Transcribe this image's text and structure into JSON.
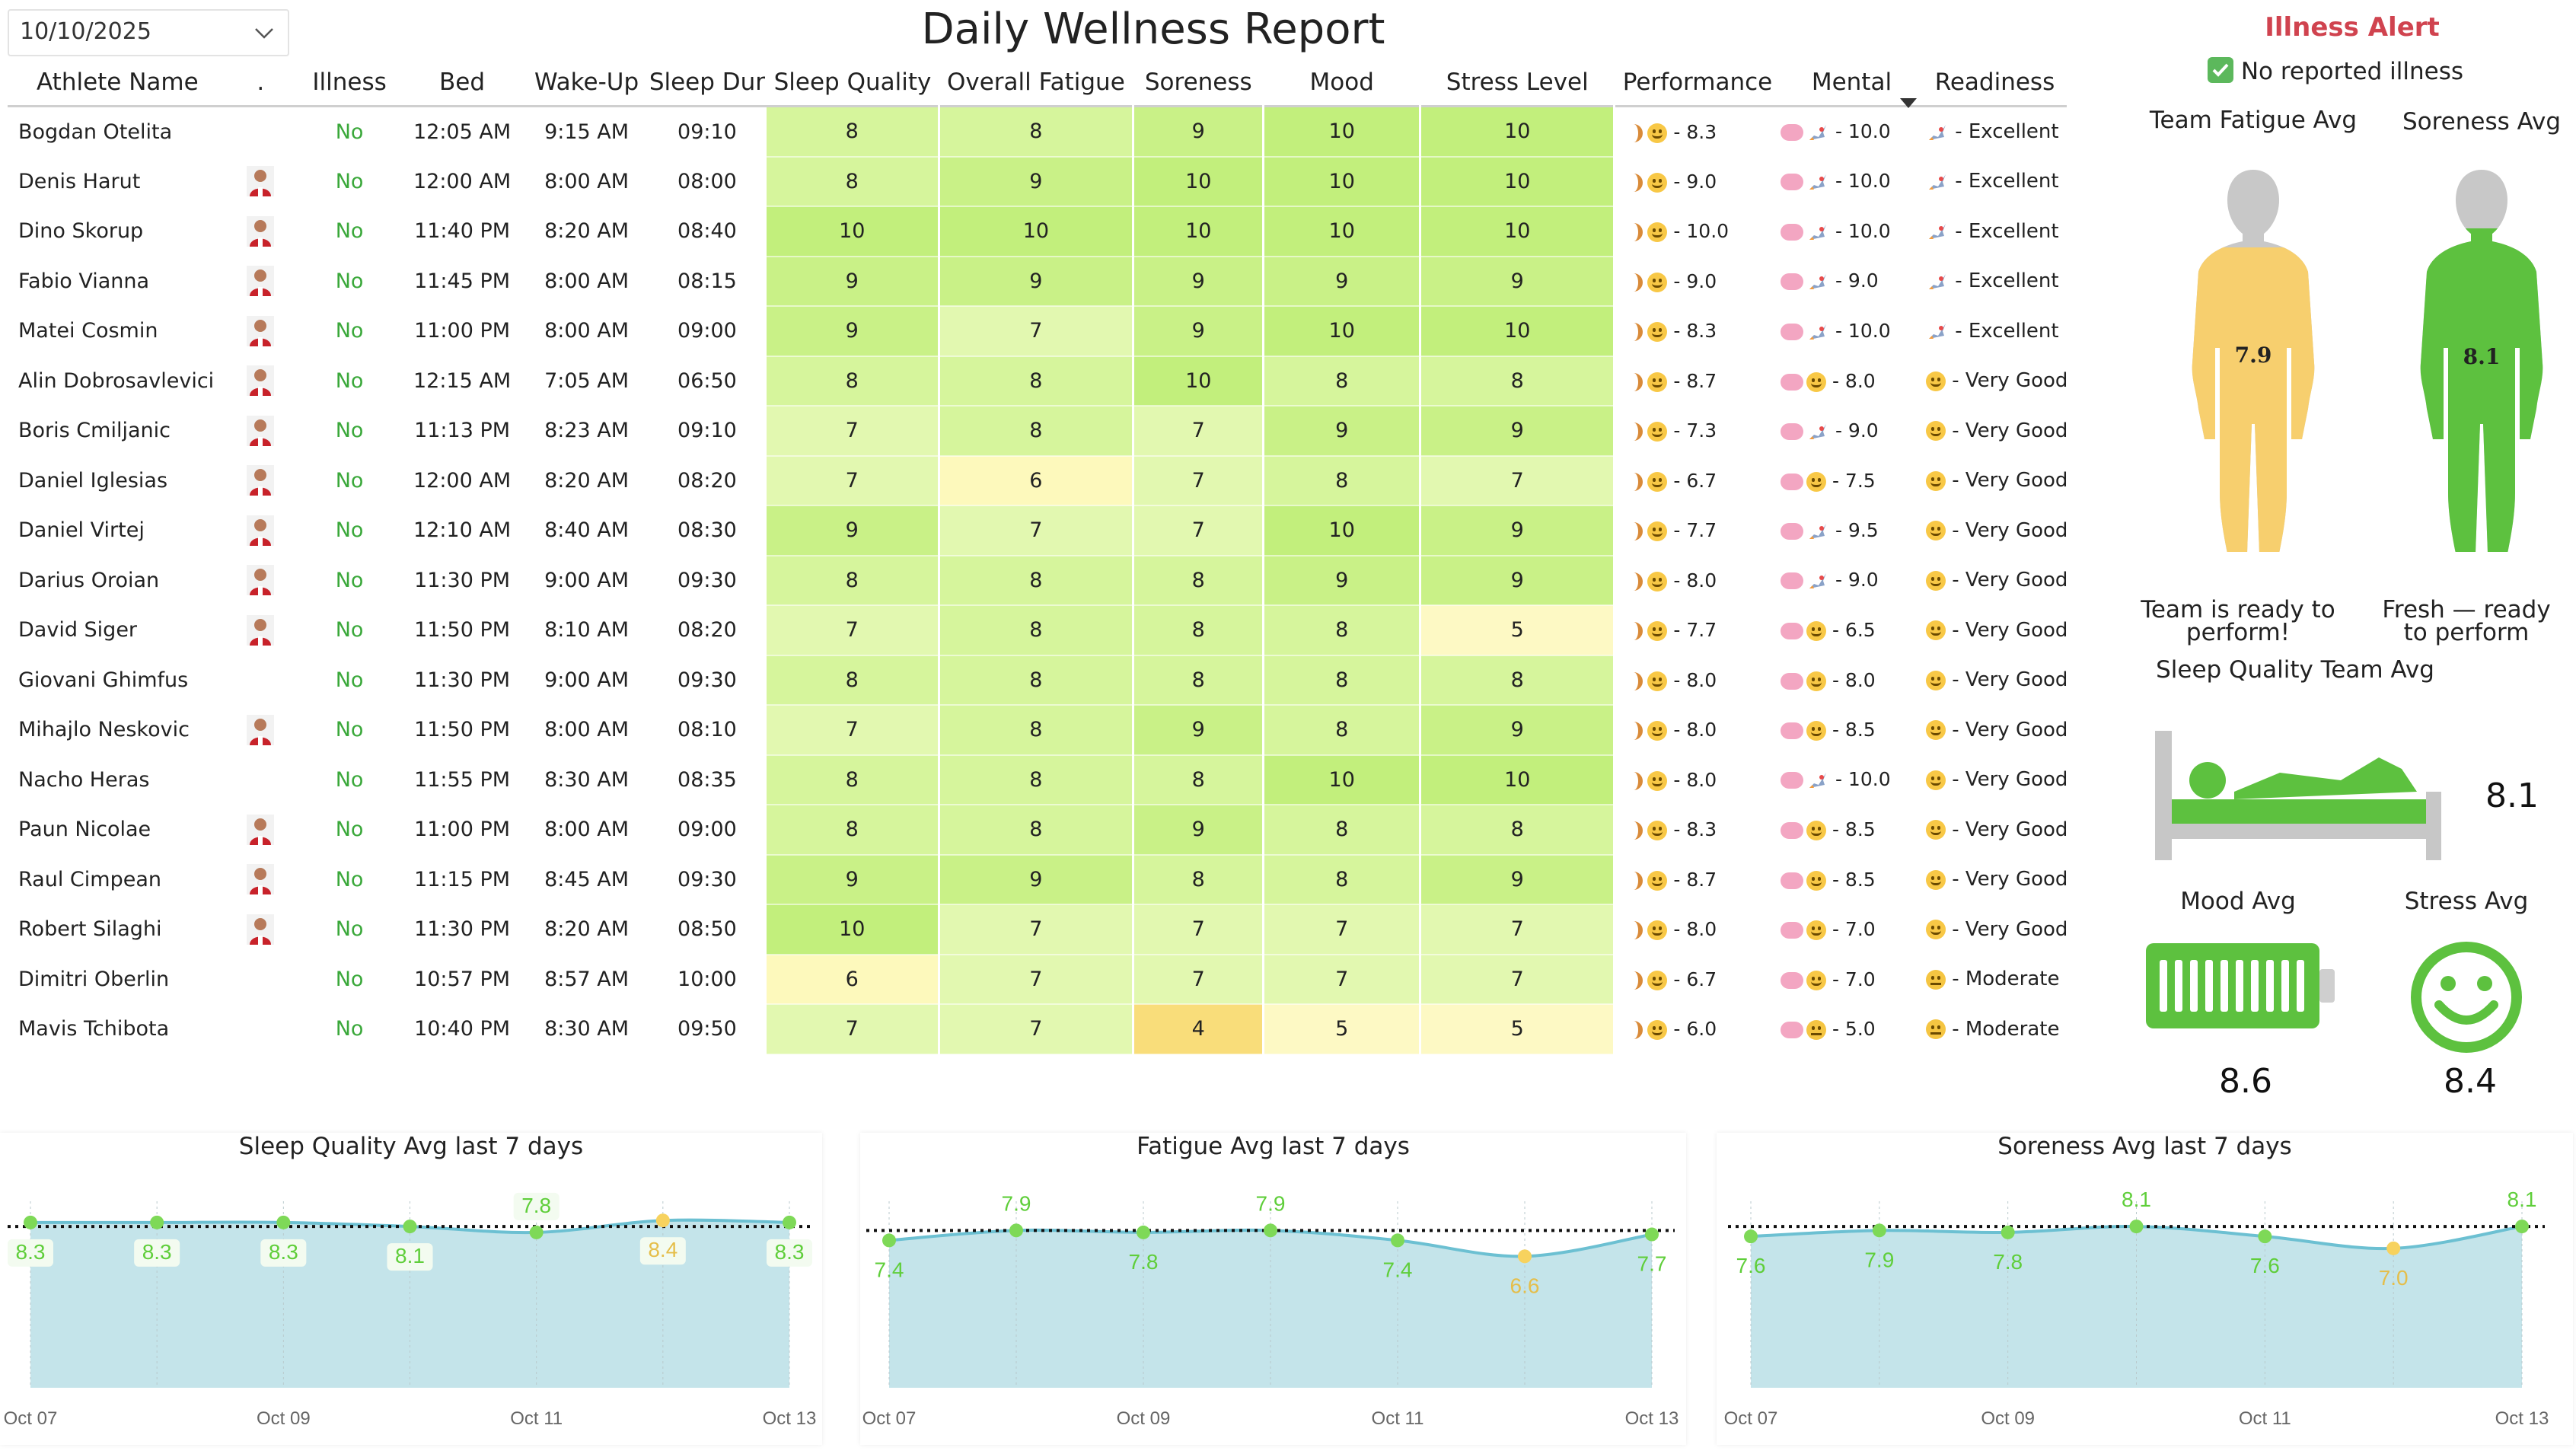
{
  "date_filter": "10/10/2025",
  "title": "Daily Wellness Report",
  "table": {
    "headers": [
      "Athlete Name",
      ".",
      "Illness",
      "Bed",
      "Wake-Up",
      "Sleep Dur",
      "Sleep Quality",
      "Overall Fatigue",
      "Soreness",
      "Mood",
      "Stress Level",
      "Performance",
      "Mental",
      "Readiness"
    ],
    "rows": [
      {
        "name": "Bogdan Otelita",
        "photo": false,
        "illness": "No",
        "bed": "12:05 AM",
        "wake": "9:15 AM",
        "dur": "09:10",
        "sq": "8",
        "fat": "8",
        "sor": "9",
        "mood": "10",
        "stress": "10",
        "perf": "- 8.3",
        "mental": "- 10.0",
        "mental_icon": "rocket",
        "ready": "- Excellent",
        "ready_icon": "rocket"
      },
      {
        "name": "Denis Harut",
        "photo": true,
        "illness": "No",
        "bed": "12:00 AM",
        "wake": "8:00 AM",
        "dur": "08:00",
        "sq": "8",
        "fat": "9",
        "sor": "10",
        "mood": "10",
        "stress": "10",
        "perf": "- 9.0",
        "mental": "- 10.0",
        "mental_icon": "rocket",
        "ready": "- Excellent",
        "ready_icon": "rocket"
      },
      {
        "name": "Dino Skorup",
        "photo": true,
        "illness": "No",
        "bed": "11:40 PM",
        "wake": "8:20 AM",
        "dur": "08:40",
        "sq": "10",
        "fat": "10",
        "sor": "10",
        "mood": "10",
        "stress": "10",
        "perf": "- 10.0",
        "mental": "- 10.0",
        "mental_icon": "rocket",
        "ready": "- Excellent",
        "ready_icon": "rocket"
      },
      {
        "name": "Fabio Vianna",
        "photo": true,
        "illness": "No",
        "bed": "11:45 PM",
        "wake": "8:00 AM",
        "dur": "08:15",
        "sq": "9",
        "fat": "9",
        "sor": "9",
        "mood": "9",
        "stress": "9",
        "perf": "- 9.0",
        "mental": "- 9.0",
        "mental_icon": "rocket",
        "ready": "- Excellent",
        "ready_icon": "rocket"
      },
      {
        "name": "Matei Cosmin",
        "photo": true,
        "illness": "No",
        "bed": "11:00 PM",
        "wake": "8:00 AM",
        "dur": "09:00",
        "sq": "9",
        "fat": "7",
        "sor": "9",
        "mood": "10",
        "stress": "10",
        "perf": "- 8.3",
        "mental": "- 10.0",
        "mental_icon": "rocket",
        "ready": "- Excellent",
        "ready_icon": "rocket"
      },
      {
        "name": "Alin Dobrosavlevici",
        "photo": true,
        "illness": "No",
        "bed": "12:15 AM",
        "wake": "7:05 AM",
        "dur": "06:50",
        "sq": "8",
        "fat": "8",
        "sor": "10",
        "mood": "8",
        "stress": "8",
        "perf": "- 8.7",
        "mental": "- 8.0",
        "mental_icon": "smile",
        "ready": "- Very Good",
        "ready_icon": "smile"
      },
      {
        "name": "Boris Cmiljanic",
        "photo": true,
        "illness": "No",
        "bed": "11:13 PM",
        "wake": "8:23 AM",
        "dur": "09:10",
        "sq": "7",
        "fat": "8",
        "sor": "7",
        "mood": "9",
        "stress": "9",
        "perf": "- 7.3",
        "mental": "- 9.0",
        "mental_icon": "rocket",
        "ready": "- Very Good",
        "ready_icon": "smile"
      },
      {
        "name": "Daniel Iglesias",
        "photo": true,
        "illness": "No",
        "bed": "12:00 AM",
        "wake": "8:20 AM",
        "dur": "08:20",
        "sq": "7",
        "fat": "6",
        "sor": "7",
        "mood": "8",
        "stress": "7",
        "perf": "- 6.7",
        "mental": "- 7.5",
        "mental_icon": "smile",
        "ready": "- Very Good",
        "ready_icon": "smile"
      },
      {
        "name": "Daniel Virtej",
        "photo": true,
        "illness": "No",
        "bed": "12:10 AM",
        "wake": "8:40 AM",
        "dur": "08:30",
        "sq": "9",
        "fat": "7",
        "sor": "7",
        "mood": "10",
        "stress": "9",
        "perf": "- 7.7",
        "mental": "- 9.5",
        "mental_icon": "rocket",
        "ready": "- Very Good",
        "ready_icon": "smile"
      },
      {
        "name": "Darius Oroian",
        "photo": true,
        "illness": "No",
        "bed": "11:30 PM",
        "wake": "9:00 AM",
        "dur": "09:30",
        "sq": "8",
        "fat": "8",
        "sor": "8",
        "mood": "9",
        "stress": "9",
        "perf": "- 8.0",
        "mental": "- 9.0",
        "mental_icon": "rocket",
        "ready": "- Very Good",
        "ready_icon": "smile"
      },
      {
        "name": "David Siger",
        "photo": true,
        "illness": "No",
        "bed": "11:50 PM",
        "wake": "8:10 AM",
        "dur": "08:20",
        "sq": "7",
        "fat": "8",
        "sor": "8",
        "mood": "8",
        "stress": "5",
        "perf": "- 7.7",
        "mental": "- 6.5",
        "mental_icon": "smile",
        "ready": "- Very Good",
        "ready_icon": "smile"
      },
      {
        "name": "Giovani Ghimfus",
        "photo": false,
        "illness": "No",
        "bed": "11:30 PM",
        "wake": "9:00 AM",
        "dur": "09:30",
        "sq": "8",
        "fat": "8",
        "sor": "8",
        "mood": "8",
        "stress": "8",
        "perf": "- 8.0",
        "mental": "- 8.0",
        "mental_icon": "smile",
        "ready": "- Very Good",
        "ready_icon": "smile"
      },
      {
        "name": "Mihajlo Neskovic",
        "photo": true,
        "illness": "No",
        "bed": "11:50 PM",
        "wake": "8:00 AM",
        "dur": "08:10",
        "sq": "7",
        "fat": "8",
        "sor": "9",
        "mood": "8",
        "stress": "9",
        "perf": "- 8.0",
        "mental": "- 8.5",
        "mental_icon": "smile",
        "ready": "- Very Good",
        "ready_icon": "smile"
      },
      {
        "name": "Nacho Heras",
        "photo": false,
        "illness": "No",
        "bed": "11:55 PM",
        "wake": "8:30 AM",
        "dur": "08:35",
        "sq": "8",
        "fat": "8",
        "sor": "8",
        "mood": "10",
        "stress": "10",
        "perf": "- 8.0",
        "mental": "- 10.0",
        "mental_icon": "rocket",
        "ready": "- Very Good",
        "ready_icon": "smile"
      },
      {
        "name": "Paun Nicolae",
        "photo": true,
        "illness": "No",
        "bed": "11:00 PM",
        "wake": "8:00 AM",
        "dur": "09:00",
        "sq": "8",
        "fat": "8",
        "sor": "9",
        "mood": "8",
        "stress": "8",
        "perf": "- 8.3",
        "mental": "- 8.5",
        "mental_icon": "smile",
        "ready": "- Very Good",
        "ready_icon": "smile"
      },
      {
        "name": "Raul Cimpean",
        "photo": true,
        "illness": "No",
        "bed": "11:15 PM",
        "wake": "8:45 AM",
        "dur": "09:30",
        "sq": "9",
        "fat": "9",
        "sor": "8",
        "mood": "8",
        "stress": "9",
        "perf": "- 8.7",
        "mental": "- 8.5",
        "mental_icon": "smile",
        "ready": "- Very Good",
        "ready_icon": "smile"
      },
      {
        "name": "Robert Silaghi",
        "photo": true,
        "illness": "No",
        "bed": "11:30 PM",
        "wake": "8:20 AM",
        "dur": "08:50",
        "sq": "10",
        "fat": "7",
        "sor": "7",
        "mood": "7",
        "stress": "7",
        "perf": "- 8.0",
        "mental": "- 7.0",
        "mental_icon": "smile",
        "ready": "- Very Good",
        "ready_icon": "smile"
      },
      {
        "name": "Dimitri Oberlin",
        "photo": false,
        "illness": "No",
        "bed": "10:57 PM",
        "wake": "8:57 AM",
        "dur": "10:00",
        "sq": "6",
        "fat": "7",
        "sor": "7",
        "mood": "7",
        "stress": "7",
        "perf": "- 6.7",
        "mental": "- 7.0",
        "mental_icon": "smile",
        "ready": "- Moderate",
        "ready_icon": "neutral"
      },
      {
        "name": "Mavis Tchibota",
        "photo": false,
        "illness": "No",
        "bed": "10:40 PM",
        "wake": "8:30 AM",
        "dur": "09:50",
        "sq": "7",
        "fat": "7",
        "sor": "4",
        "mood": "5",
        "stress": "5",
        "perf": "- 6.0",
        "mental": "- 5.0",
        "mental_icon": "neutral",
        "ready": "- Moderate",
        "ready_icon": "neutral"
      }
    ]
  },
  "side": {
    "alert_title": "Illness Alert",
    "alert_msg": "No reported illness",
    "fatigue_label": "Team Fatigue Avg",
    "fatigue_value": "7.9",
    "fatigue_note": "Team is ready to perform!",
    "soreness_label": "Soreness Avg",
    "soreness_value": "8.1",
    "soreness_note": "Fresh — ready to perform",
    "sleep_label": "Sleep Quality Team Avg",
    "sleep_value": "8.1",
    "mood_label": "Mood Avg",
    "mood_value": "8.6",
    "stress_label": "Stress Avg",
    "stress_value": "8.4",
    "colors": {
      "fatigue_body": "#f7cf6e",
      "soreness_body": "#5dc13f",
      "green": "#5dc13f",
      "alert": "#d0434f"
    }
  },
  "chart_data": [
    {
      "type": "area",
      "title": "Sleep Quality Avg last 7 days",
      "x": [
        "Oct 07",
        "Oct 08",
        "Oct 09",
        "Oct 10",
        "Oct 11",
        "Oct 12",
        "Oct 13"
      ],
      "values": [
        8.3,
        8.3,
        8.3,
        8.1,
        7.8,
        8.4,
        8.3
      ],
      "labels": [
        "8.3",
        "8.3",
        "8.3",
        "8.1",
        "7.8",
        "8.4",
        "8.3"
      ],
      "xticks": [
        "Oct 07",
        "Oct 09",
        "Oct 11",
        "Oct 13"
      ],
      "ylim": [
        0,
        8.6
      ],
      "reference": 8.1
    },
    {
      "type": "area",
      "title": "Fatigue Avg last 7 days",
      "x": [
        "Oct 07",
        "Oct 08",
        "Oct 09",
        "Oct 10",
        "Oct 11",
        "Oct 12",
        "Oct 13"
      ],
      "values": [
        7.4,
        7.9,
        7.8,
        7.9,
        7.4,
        6.6,
        7.7
      ],
      "labels": [
        "7.4",
        "7.9",
        "7.8",
        "7.9",
        "7.4",
        "6.6",
        "7.7"
      ],
      "xticks": [
        "Oct 07",
        "Oct 09",
        "Oct 11",
        "Oct 13"
      ],
      "ylim": [
        0,
        8.6
      ],
      "reference": 7.9
    },
    {
      "type": "area",
      "title": "Soreness Avg last 7 days",
      "x": [
        "Oct 07",
        "Oct 08",
        "Oct 09",
        "Oct 10",
        "Oct 11",
        "Oct 12",
        "Oct 13"
      ],
      "values": [
        7.6,
        7.9,
        7.8,
        8.1,
        7.6,
        7.0,
        8.1
      ],
      "labels": [
        "7.6",
        "7.9",
        "7.8",
        "8.1",
        "7.6",
        "7.0",
        "8.1"
      ],
      "xticks": [
        "Oct 07",
        "Oct 09",
        "Oct 11",
        "Oct 13"
      ],
      "ylim": [
        0,
        8.6
      ],
      "reference": 8.1
    }
  ]
}
